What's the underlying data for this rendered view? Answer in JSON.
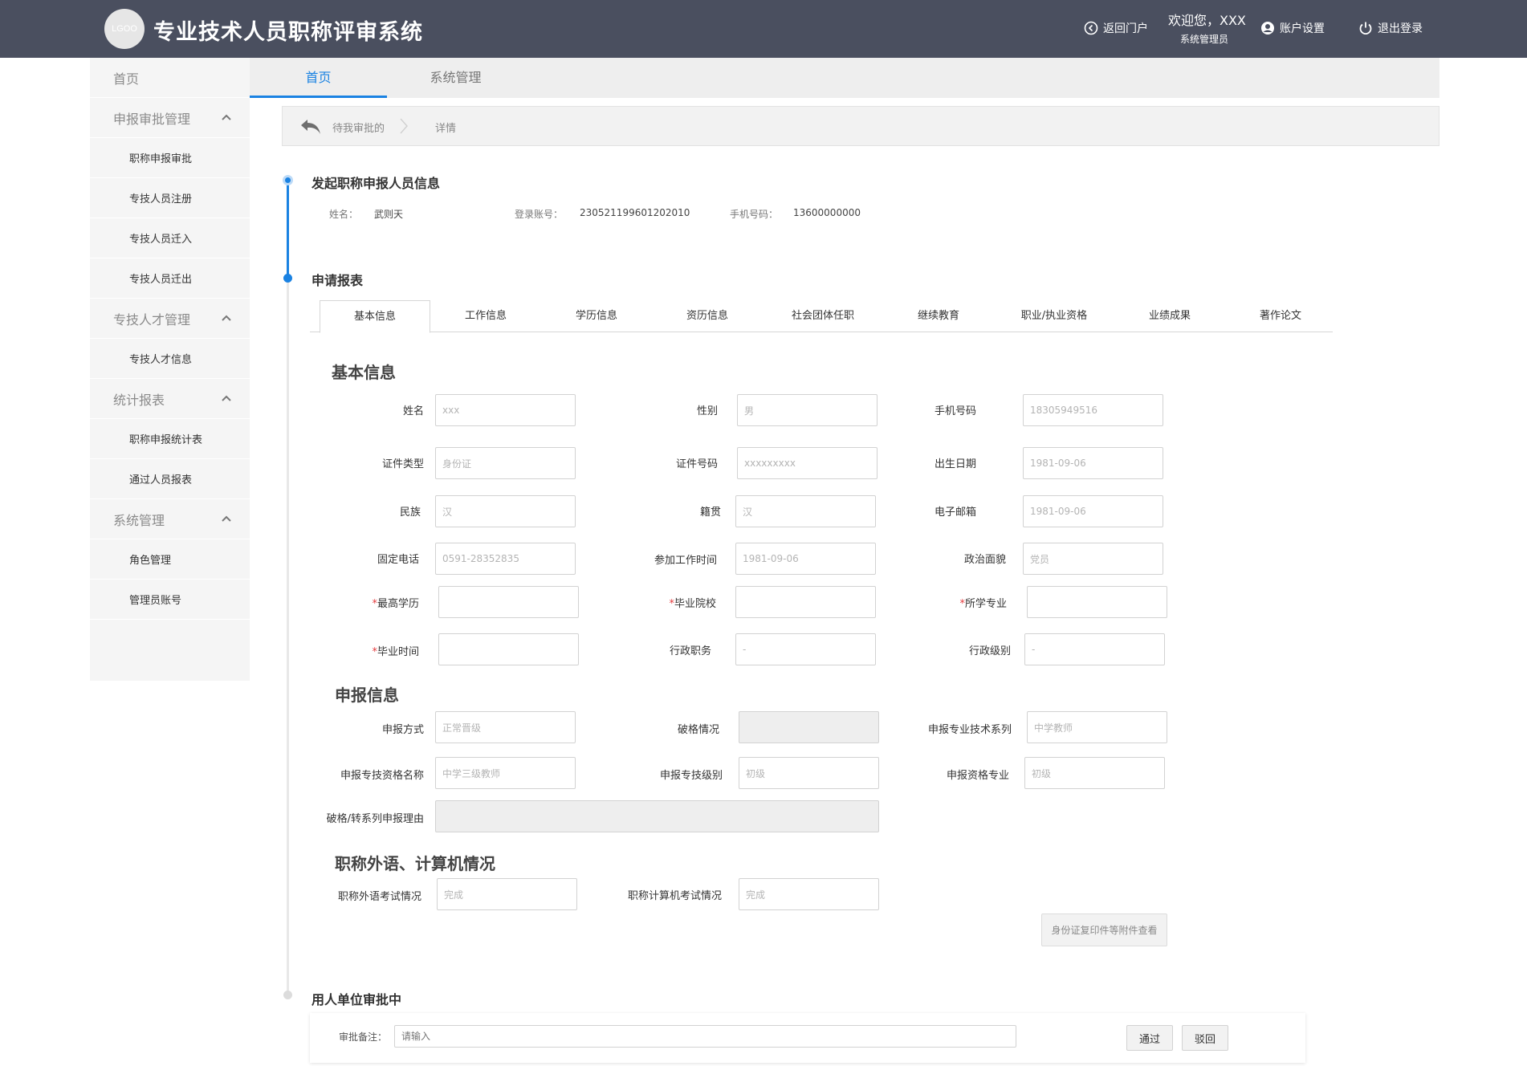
{
  "header": {
    "logo_text": "LGOO",
    "app_title": "专业技术人员职称评审系统",
    "back_portal": "返回门户",
    "welcome": "欢迎您，XXX",
    "role": "系统管理员",
    "account_settings": "账户设置",
    "logout": "退出登录"
  },
  "sidebar": {
    "home": "首页",
    "groups": [
      {
        "title": "申报审批管理",
        "items": [
          "职称申报审批",
          "专技人员注册",
          "专技人员迁入",
          "专技人员迁出"
        ]
      },
      {
        "title": "专技人才管理",
        "items": [
          "专技人才信息"
        ]
      },
      {
        "title": "统计报表",
        "items": [
          "职称申报统计表",
          "通过人员报表"
        ]
      },
      {
        "title": "系统管理",
        "items": [
          "角色管理",
          "管理员账号"
        ]
      }
    ]
  },
  "top_tabs": [
    "首页",
    "系统管理"
  ],
  "breadcrumb": {
    "parent": "待我审批的",
    "current": "详情"
  },
  "applicant": {
    "section_title": "发起职称申报人员信息",
    "name_label": "姓名：",
    "name": "武则天",
    "account_label": "登录账号：",
    "account": "230521199601202010",
    "phone_label": "手机号码：",
    "phone": "13600000000"
  },
  "form_section_title": "申请报表",
  "form_tabs": [
    "基本信息",
    "工作信息",
    "学历信息",
    "资历信息",
    "社会团体任职",
    "继续教育",
    "职业/执业资格",
    "业绩成果",
    "著作论文"
  ],
  "basic": {
    "title": "基本信息",
    "fields": {
      "name": {
        "label": "姓名",
        "value": "xxx"
      },
      "gender": {
        "label": "性别",
        "value": "男"
      },
      "mobile": {
        "label": "手机号码",
        "value": "18305949516"
      },
      "id_type": {
        "label": "证件类型",
        "value": "身份证"
      },
      "id_no": {
        "label": "证件号码",
        "value": "xxxxxxxxx"
      },
      "birth": {
        "label": "出生日期",
        "value": "1981-09-06"
      },
      "ethnic": {
        "label": "民族",
        "value": "汉"
      },
      "native": {
        "label": "籍贯",
        "value": "汉"
      },
      "email": {
        "label": "电子邮箱",
        "value": "1981-09-06"
      },
      "tel": {
        "label": "固定电话",
        "value": "0591-28352835"
      },
      "work_start": {
        "label": "参加工作时间",
        "value": "1981-09-06"
      },
      "political": {
        "label": "政治面貌",
        "value": "党员"
      },
      "edu": {
        "label": "最高学历",
        "value": ""
      },
      "school": {
        "label": "毕业院校",
        "value": ""
      },
      "major": {
        "label": "所学专业",
        "value": ""
      },
      "grad_time": {
        "label": "毕业时间",
        "value": ""
      },
      "admin_post": {
        "label": "行政职务",
        "value": "-"
      },
      "admin_level": {
        "label": "行政级别",
        "value": "-"
      }
    },
    "required_mark": "*"
  },
  "declare": {
    "title": "申报信息",
    "fields": {
      "method": {
        "label": "申报方式",
        "value": "正常晋级"
      },
      "break": {
        "label": "破格情况",
        "value": ""
      },
      "series": {
        "label": "申报专业技术系列",
        "value": "中学教师"
      },
      "qual_name": {
        "label": "申报专技资格名称",
        "value": "中学三级教师"
      },
      "level": {
        "label": "申报专技级别",
        "value": "初级"
      },
      "qual_major": {
        "label": "申报资格专业",
        "value": "初级"
      },
      "reason": {
        "label": "破格/转系列申报理由",
        "value": ""
      }
    }
  },
  "lang": {
    "title": "职称外语、计算机情况",
    "foreign": {
      "label": "职称外语考试情况",
      "value": "完成"
    },
    "computer": {
      "label": "职称计算机考试情况",
      "value": "完成"
    }
  },
  "attach_button": "身份证复印件等附件查看",
  "approval": {
    "section_title": "用人单位审批中",
    "remark_label": "审批备注：",
    "remark_placeholder": "请输入",
    "pass": "通过",
    "reject": "驳回"
  },
  "colors": {
    "header_bg": "#4a4f5f",
    "accent": "#1a82e2",
    "required": "#e4393c"
  }
}
